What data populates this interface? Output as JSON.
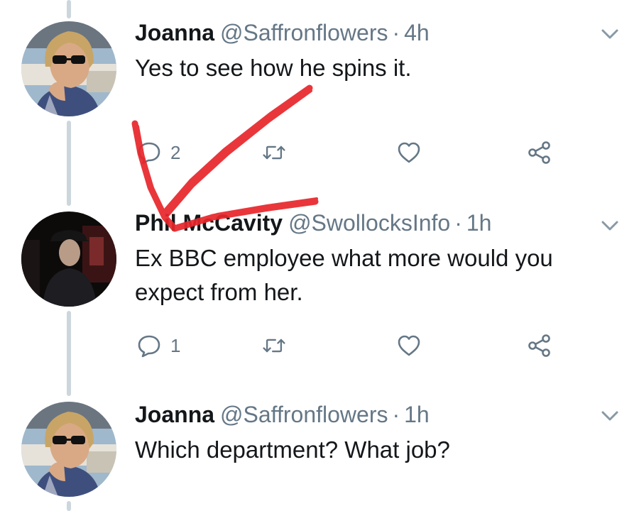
{
  "tweets": [
    {
      "display_name": "Joanna",
      "handle": "@Saffronflowers",
      "separator": "·",
      "time": "4h",
      "text": "Yes to see how he spins it.",
      "reply_count": "2",
      "retweet_count": "",
      "like_count": ""
    },
    {
      "display_name": "Phil McCavity",
      "handle": "@SwollocksInfo",
      "separator": "·",
      "time": "1h",
      "text": "Ex BBC employee what more would you expect from her.",
      "reply_count": "1",
      "retweet_count": "",
      "like_count": ""
    },
    {
      "display_name": "Joanna",
      "handle": "@Saffronflowers",
      "separator": "·",
      "time": "1h",
      "text": "Which department? What job?"
    }
  ],
  "icons": {
    "reply": "reply-icon",
    "retweet": "retweet-icon",
    "like": "heart-icon",
    "share": "share-icon",
    "more": "chevron-down-icon"
  },
  "colors": {
    "text_primary": "#14171a",
    "text_secondary": "#657786",
    "thread_line": "#ccd6dd",
    "annotation": "#e8262b"
  }
}
